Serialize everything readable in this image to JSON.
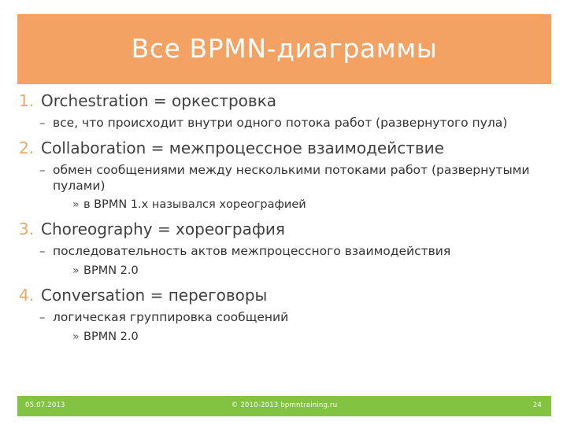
{
  "slide": {
    "title": "Все BPMN-диаграммы",
    "colors": {
      "title_banner": "#F4A264",
      "title_text": "#FFFFFF",
      "footer_bar": "#82C341",
      "footer_text": "#FFFFFF",
      "number_accent": "#E8A86A",
      "body_text": "#333333",
      "background": "#FFFFFF"
    },
    "items": [
      {
        "number": "1.",
        "title": "Orchestration = оркестровка",
        "sub": [
          {
            "marker": "–",
            "text": "все, что происходит внутри одного потока работ (развернутого пула)",
            "sub": []
          }
        ]
      },
      {
        "number": "2.",
        "title": "Collaboration = межпроцессное взаимодействие",
        "sub": [
          {
            "marker": "–",
            "text": "обмен сообщениями между несколькими потоками работ (развернутыми пулами)",
            "sub": [
              {
                "marker": "»",
                "text": "в BPMN 1.x назывался хореографией"
              }
            ]
          }
        ]
      },
      {
        "number": "3.",
        "title": "Choreography = хореография",
        "sub": [
          {
            "marker": "–",
            "text": "последовательность актов межпроцессного взаимодействия",
            "sub": [
              {
                "marker": "»",
                "text": "BPMN 2.0"
              }
            ]
          }
        ]
      },
      {
        "number": "4.",
        "title": "Conversation = переговоры",
        "sub": [
          {
            "marker": "–",
            "text": "логическая группировка сообщений",
            "sub": [
              {
                "marker": "»",
                "text": "BPMN 2.0"
              }
            ]
          }
        ]
      }
    ],
    "footer": {
      "date": "05.07.2013",
      "copyright": "© 2010-2013 bpmntraining.ru",
      "page_number": "24"
    }
  }
}
